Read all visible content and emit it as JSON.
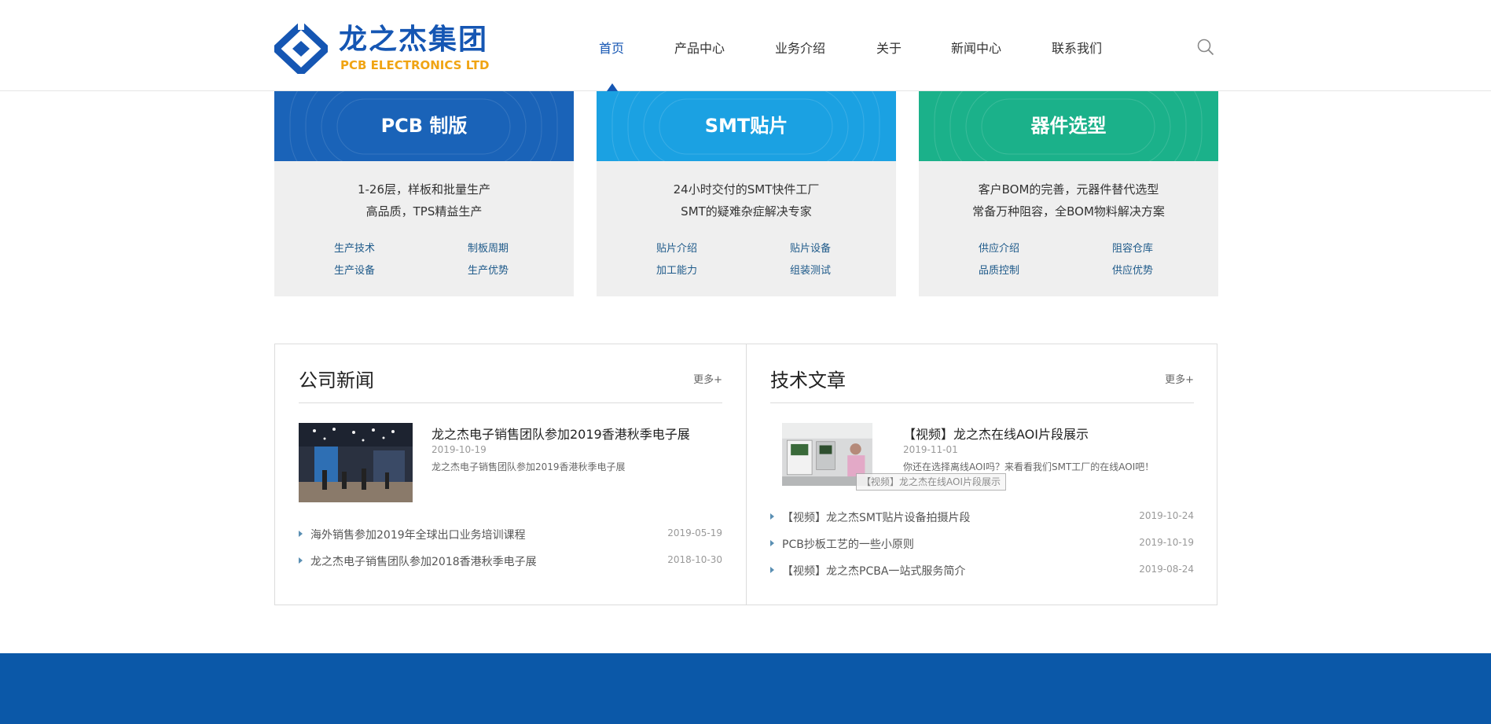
{
  "header": {
    "logo_cn": "龙之杰集团",
    "logo_en": "PCB ELECTRONICS LTD",
    "nav": [
      "首页",
      "产品中心",
      "业务介绍",
      "关于",
      "新闻中心",
      "联系我们"
    ],
    "active_nav": "首页"
  },
  "services": [
    {
      "title": "PCB 制版",
      "color": "#1a63b8",
      "lines": [
        "1-26层，样板和批量生产",
        "高品质，TPS精益生产"
      ],
      "links": [
        "生产技术",
        "制板周期",
        "生产设备",
        "生产优势"
      ]
    },
    {
      "title": "SMT贴片",
      "color": "#1ba1e2",
      "lines": [
        "24小时交付的SMT快件工厂",
        "SMT的疑难杂症解决专家"
      ],
      "links": [
        "贴片介绍",
        "贴片设备",
        "加工能力",
        "组装测试"
      ]
    },
    {
      "title": "器件选型",
      "color": "#1bb18a",
      "lines": [
        "客户BOM的完善，元器件替代选型",
        "常备万种阻容，全BOM物料解决方案"
      ],
      "links": [
        "供应介绍",
        "阻容仓库",
        "品质控制",
        "供应优势"
      ]
    }
  ],
  "company_news": {
    "title": "公司新闻",
    "more": "更多+",
    "featured": {
      "title": "龙之杰电子销售团队参加2019香港秋季电子展",
      "date": "2019-10-19",
      "summary": "龙之杰电子销售团队参加2019香港秋季电子展"
    },
    "items": [
      {
        "text": "海外销售参加2019年全球出口业务培训课程",
        "date": "2019-05-19"
      },
      {
        "text": "龙之杰电子销售团队参加2018香港秋季电子展",
        "date": "2018-10-30"
      }
    ]
  },
  "tech_articles": {
    "title": "技术文章",
    "more": "更多+",
    "featured": {
      "title": "【视频】龙之杰在线AOI片段展示",
      "date": "2019-11-01",
      "summary": "你还在选择离线AOI吗？来看看我们SMT工厂的在线AOI吧！"
    },
    "tooltip": "【视频】龙之杰在线AOI片段展示",
    "items": [
      {
        "text": "【视频】龙之杰SMT贴片设备拍摄片段",
        "date": "2019-10-24"
      },
      {
        "text": "PCB抄板工艺的一些小原则",
        "date": "2019-10-19"
      },
      {
        "text": "【视频】龙之杰PCBA一站式服务简介",
        "date": "2019-08-24"
      }
    ]
  },
  "footer": {
    "color": "#0b58a8"
  }
}
